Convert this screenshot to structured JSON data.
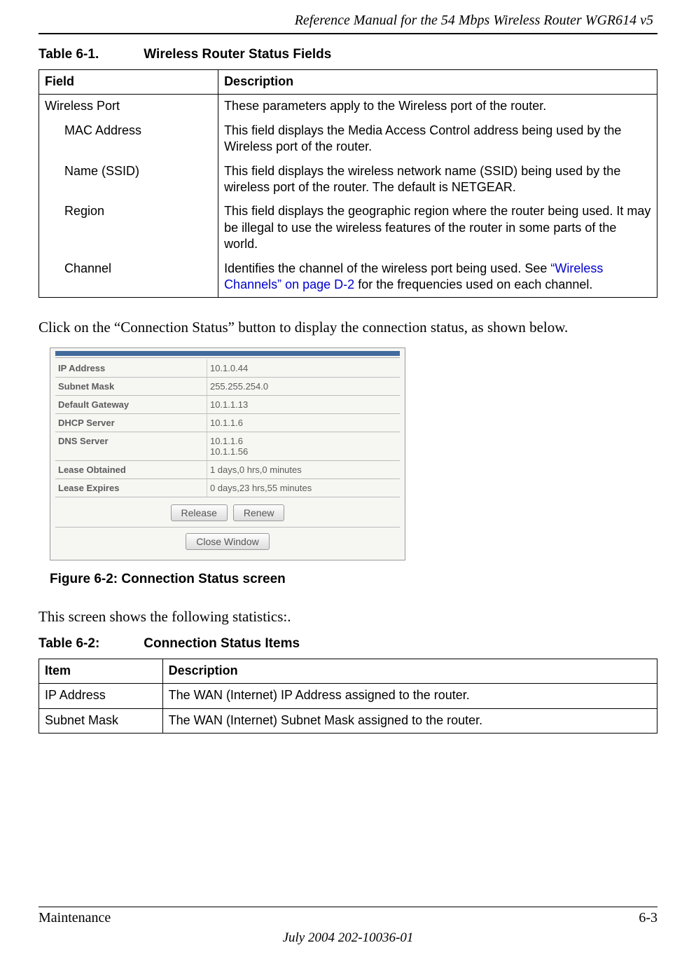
{
  "header": {
    "title": "Reference Manual for the 54 Mbps Wireless Router WGR614 v5"
  },
  "table1": {
    "label_num": "Table 6-1.",
    "label_title": "Wireless Router Status Fields",
    "headers": {
      "c1": "Field",
      "c2": "Description"
    },
    "rows": [
      {
        "field": "Wireless Port",
        "indent": false,
        "desc": "These parameters apply to the Wireless port of the router."
      },
      {
        "field": "MAC Address",
        "indent": true,
        "desc": "This field displays the Media Access Control address being used by the Wireless port of the router."
      },
      {
        "field": "Name (SSID)",
        "indent": true,
        "desc": "This field displays the wireless network name (SSID) being used by the wireless port of the router. The default is NETGEAR."
      },
      {
        "field": "Region",
        "indent": true,
        "desc": "This field displays the geographic region where the router being used. It may be illegal to use the wireless features of the router in some parts of the world."
      },
      {
        "field": "Channel",
        "indent": true,
        "desc_pre": "Identifies the channel of the wireless port being used. See ",
        "desc_link": "“Wireless Channels” on page D-2",
        "desc_post": " for the frequencies used on each channel."
      }
    ]
  },
  "body1": "Click on the “Connection Status” button to display the connection status, as shown below.",
  "figure": {
    "rows": [
      {
        "label": "IP Address",
        "value": "10.1.0.44"
      },
      {
        "label": "Subnet Mask",
        "value": "255.255.254.0"
      },
      {
        "label": "Default Gateway",
        "value": "10.1.1.13"
      },
      {
        "label": "DHCP Server",
        "value": "10.1.1.6"
      },
      {
        "label": "DNS Server",
        "value": "10.1.1.6\n10.1.1.56"
      },
      {
        "label": "Lease Obtained",
        "value": "1 days,0 hrs,0 minutes"
      },
      {
        "label": "Lease Expires",
        "value": "0 days,23 hrs,55 minutes"
      }
    ],
    "btn_release": "Release",
    "btn_renew": "Renew",
    "btn_close": "Close Window",
    "caption": "Figure 6-2:  Connection Status screen"
  },
  "body2": "This screen shows the following statistics:.",
  "table2": {
    "label_num": "Table 6-2:",
    "label_title": "Connection Status Items",
    "headers": {
      "c1": "Item",
      "c2": "Description"
    },
    "rows": [
      {
        "item": "IP Address",
        "desc": "The WAN (Internet) IP Address assigned to the router."
      },
      {
        "item": "Subnet Mask",
        "desc": "The WAN (Internet) Subnet Mask assigned to the router."
      }
    ]
  },
  "footer": {
    "left": "Maintenance",
    "right": "6-3",
    "center": "July 2004 202-10036-01"
  }
}
